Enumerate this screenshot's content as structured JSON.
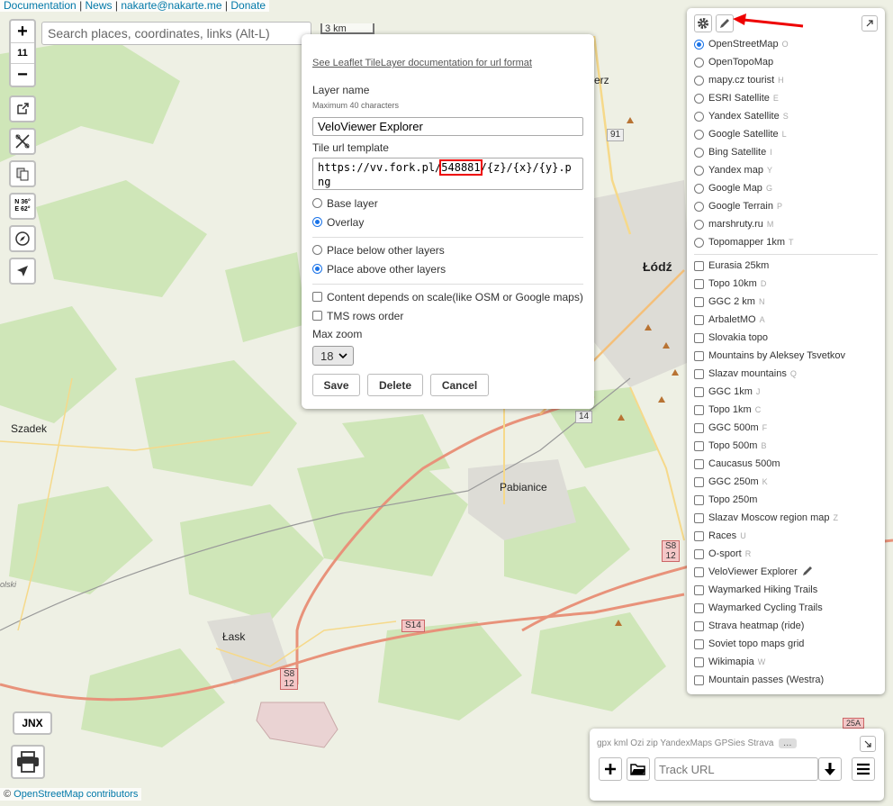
{
  "top_links": [
    "Documentation",
    "News",
    "nakarte@nakarte.me",
    "Donate"
  ],
  "zoom": {
    "in": "+",
    "level": "11",
    "out": "−"
  },
  "search": {
    "placeholder": "Search places, coordinates, links (Alt-L)"
  },
  "scale_label": "3 km",
  "coords_label": {
    "line1": "N 36°",
    "line2": "E 62°"
  },
  "jnx_label": "JNX",
  "attribution": {
    "prefix": "©",
    "link": "OpenStreetMap contributors"
  },
  "map_labels": {
    "lodz": "Łódź",
    "pabianice": "Pabianice",
    "lask": "Łask",
    "szadek": "Szadek",
    "erz": "erz",
    "olski": "olski"
  },
  "road_shields": {
    "r91": "91",
    "r14": "14",
    "s14": "S14",
    "s8a": "S8",
    "s8a2": "12",
    "s8b": "S8",
    "s8b2": "12",
    "r25a": "25A"
  },
  "dialog": {
    "doc_link": "See Leaflet TileLayer documentation for url format",
    "name_label": "Layer name",
    "name_hint": "Maximum 40 characters",
    "name_value": "VeloViewer Explorer",
    "url_label": "Tile url template",
    "url_prefix": "https://vv.fork.pl/",
    "url_highlight": "548881",
    "url_suffix": "/{z}/{x}/{y}.p",
    "url_line2": "ng",
    "type_base": "Base layer",
    "type_overlay": "Overlay",
    "pos_below": "Place below other layers",
    "pos_above": "Place above other layers",
    "scale_dep": "Content depends on scale(like OSM or Google maps)",
    "tms": "TMS rows order",
    "max_zoom_label": "Max zoom",
    "max_zoom_value": "18",
    "save": "Save",
    "delete": "Delete",
    "cancel": "Cancel"
  },
  "base_layers": [
    {
      "name": "OpenStreetMap",
      "key": "O",
      "selected": true
    },
    {
      "name": "OpenTopoMap",
      "key": ""
    },
    {
      "name": "mapy.cz tourist",
      "key": "H"
    },
    {
      "name": "ESRI Satellite",
      "key": "E"
    },
    {
      "name": "Yandex Satellite",
      "key": "S"
    },
    {
      "name": "Google Satellite",
      "key": "L"
    },
    {
      "name": "Bing Satellite",
      "key": "I"
    },
    {
      "name": "Yandex map",
      "key": "Y"
    },
    {
      "name": "Google Map",
      "key": "G"
    },
    {
      "name": "Google Terrain",
      "key": "P"
    },
    {
      "name": "marshruty.ru",
      "key": "M"
    },
    {
      "name": "Topomapper 1km",
      "key": "T"
    }
  ],
  "overlays": [
    {
      "name": "Eurasia 25km",
      "key": ""
    },
    {
      "name": "Topo 10km",
      "key": "D"
    },
    {
      "name": "GGC 2 km",
      "key": "N"
    },
    {
      "name": "ArbaletMO",
      "key": "A"
    },
    {
      "name": "Slovakia topo",
      "key": ""
    },
    {
      "name": "Mountains by Aleksey Tsvetkov",
      "key": ""
    },
    {
      "name": "Slazav mountains",
      "key": "Q"
    },
    {
      "name": "GGC 1km",
      "key": "J"
    },
    {
      "name": "Topo 1km",
      "key": "C"
    },
    {
      "name": "GGC 500m",
      "key": "F"
    },
    {
      "name": "Topo 500m",
      "key": "B"
    },
    {
      "name": "Caucasus 500m",
      "key": ""
    },
    {
      "name": "GGC 250m",
      "key": "K"
    },
    {
      "name": "Topo 250m",
      "key": ""
    },
    {
      "name": "Slazav Moscow region map",
      "key": "Z"
    },
    {
      "name": "Races",
      "key": "U"
    },
    {
      "name": "O-sport",
      "key": "R"
    },
    {
      "name": "VeloViewer Explorer",
      "key": "",
      "editable": true
    },
    {
      "name": "Waymarked Hiking Trails",
      "key": ""
    },
    {
      "name": "Waymarked Cycling Trails",
      "key": ""
    },
    {
      "name": "Strava heatmap (ride)",
      "key": ""
    },
    {
      "name": "Soviet topo maps grid",
      "key": ""
    },
    {
      "name": "Wikimapia",
      "key": "W"
    },
    {
      "name": "Mountain passes (Westra)",
      "key": ""
    }
  ],
  "track": {
    "formats": "gpx kml Ozi zip YandexMaps GPSies Strava",
    "more": "…",
    "url_placeholder": "Track URL"
  },
  "icons": {
    "gear": "gear-icon",
    "pencil": "pencil-icon",
    "arrow": "red-arrow-annotation",
    "accent": "#1a73e8",
    "highlight": "#e00000"
  }
}
